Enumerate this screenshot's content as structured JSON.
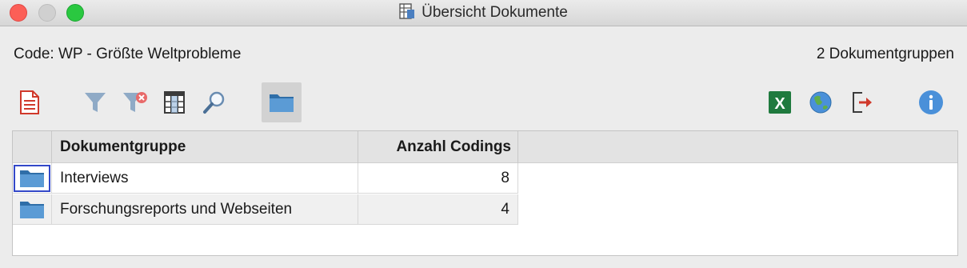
{
  "window": {
    "title": "Übersicht Dokumente"
  },
  "info": {
    "code_label": "Code: WP - Größte Weltprobleme",
    "group_count": "2 Dokumentgruppen"
  },
  "toolbar": {
    "left_icons": [
      "document-icon",
      "filter-icon",
      "clear-filter-icon",
      "table-columns-icon",
      "search-icon",
      "folder-icon"
    ],
    "right_icons": [
      "excel-export-icon",
      "globe-icon",
      "export-icon",
      "info-icon"
    ]
  },
  "table": {
    "columns": [
      "Dokumentgruppe",
      "Anzahl Codings"
    ],
    "rows": [
      {
        "name": "Interviews",
        "count": "8"
      },
      {
        "name": "Forschungsreports und Webseiten",
        "count": "4"
      }
    ]
  },
  "colors": {
    "accent_folder": "#5b9bd5",
    "excel_green": "#1f7a3e",
    "info_blue": "#4a90d9",
    "error_red": "#d0392b"
  }
}
